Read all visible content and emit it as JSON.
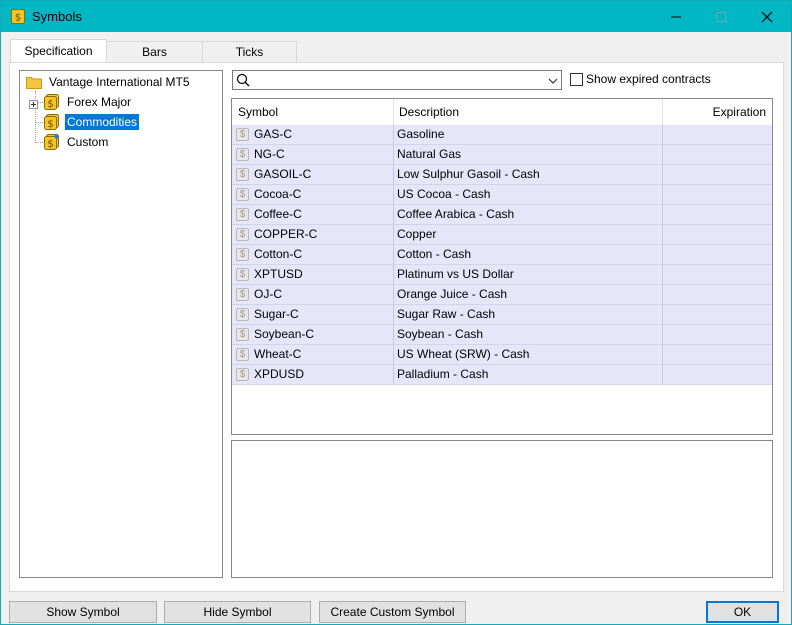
{
  "window": {
    "title": "Symbols",
    "controls": {
      "minimize": "minimize-icon",
      "maximize": "maximize-icon",
      "close": "close-icon"
    },
    "accent": "#00b7c3"
  },
  "tabs": [
    {
      "label": "Specification",
      "active": true
    },
    {
      "label": "Bars",
      "active": false
    },
    {
      "label": "Ticks",
      "active": false
    }
  ],
  "tree": {
    "root": {
      "label": "Vantage International MT5",
      "icon": "folder-icon"
    },
    "children": [
      {
        "label": "Forex Major",
        "icon": "dollar-group-icon",
        "expandable": true,
        "selected": false
      },
      {
        "label": "Commodities",
        "icon": "dollar-group-icon",
        "expandable": false,
        "selected": true
      },
      {
        "label": "Custom",
        "icon": "dollar-group-custom-icon",
        "expandable": false,
        "selected": false
      }
    ]
  },
  "search": {
    "value": "",
    "placeholder": "",
    "icon": "search-icon"
  },
  "show_expired": {
    "label": "Show expired contracts",
    "checked": false
  },
  "table": {
    "columns": [
      "Symbol",
      "Description",
      "Expiration"
    ],
    "rows": [
      {
        "symbol": "GAS-C",
        "description": "Gasoline",
        "expiration": ""
      },
      {
        "symbol": "NG-C",
        "description": "Natural Gas",
        "expiration": ""
      },
      {
        "symbol": "GASOIL-C",
        "description": "Low Sulphur Gasoil - Cash",
        "expiration": ""
      },
      {
        "symbol": "Cocoa-C",
        "description": "US Cocoa - Cash",
        "expiration": ""
      },
      {
        "symbol": "Coffee-C",
        "description": "Coffee Arabica - Cash",
        "expiration": ""
      },
      {
        "symbol": "COPPER-C",
        "description": "Copper",
        "expiration": ""
      },
      {
        "symbol": "Cotton-C",
        "description": "Cotton - Cash",
        "expiration": ""
      },
      {
        "symbol": "XPTUSD",
        "description": "Platinum vs US Dollar",
        "expiration": ""
      },
      {
        "symbol": "OJ-C",
        "description": "Orange Juice - Cash",
        "expiration": ""
      },
      {
        "symbol": "Sugar-C",
        "description": "Sugar Raw - Cash",
        "expiration": ""
      },
      {
        "symbol": "Soybean-C",
        "description": "Soybean - Cash",
        "expiration": ""
      },
      {
        "symbol": "Wheat-C",
        "description": "US Wheat (SRW) - Cash",
        "expiration": ""
      },
      {
        "symbol": "XPDUSD",
        "description": "Palladium - Cash",
        "expiration": ""
      }
    ],
    "row_color": "#e6e6fa"
  },
  "buttons": {
    "show_symbol": "Show Symbol",
    "hide_symbol": "Hide Symbol",
    "create_custom": "Create Custom Symbol",
    "ok": "OK"
  }
}
